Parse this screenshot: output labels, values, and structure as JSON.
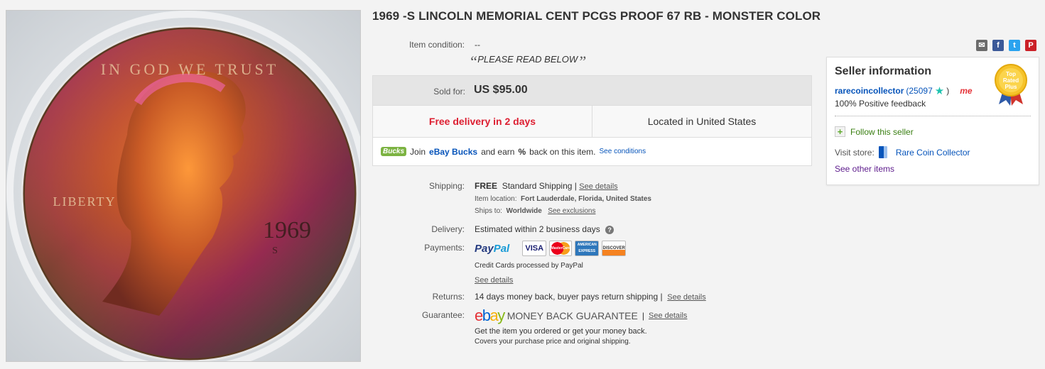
{
  "title": "1969 -S LINCOLN MEMORIAL CENT PCGS PROOF 67 RB - MONSTER COLOR",
  "condition": {
    "label": "Item condition:",
    "value": "--",
    "note": "PLEASE READ BELOW",
    "open_quote": "“",
    "close_quote": "”"
  },
  "share_icons": [
    "email-icon",
    "facebook-icon",
    "twitter-icon",
    "pinterest-icon"
  ],
  "sold": {
    "label": "Sold for:",
    "price": "US $95.00",
    "delivery": "Free delivery in 2 days",
    "location": "Located in United States"
  },
  "bucks": {
    "badge": "Bucks",
    "join": "Join",
    "brand": "eBay Bucks",
    "and_earn": "and earn",
    "percent": "%",
    "back_text": "back on this item.",
    "see_conditions": "See conditions"
  },
  "shipping": {
    "label": "Shipping:",
    "free": "FREE",
    "method": "Standard Shipping",
    "sep": "|",
    "see_details": "See details",
    "item_location_label": "Item location:",
    "item_location": "Fort Lauderdale, Florida, United States",
    "ships_to_label": "Ships to:",
    "ships_to": "Worldwide",
    "see_exclusions": "See exclusions"
  },
  "delivery": {
    "label": "Delivery:",
    "value": "Estimated within 2 business days",
    "help": "?"
  },
  "payments": {
    "label": "Payments:",
    "paypal_pay": "Pay",
    "paypal_pal": "Pal",
    "cards": [
      "VISA",
      "MasterCard",
      "AMERICAN EXPRESS",
      "DISCOVER"
    ],
    "note": "Credit Cards processed by PayPal",
    "see_details": "See details"
  },
  "returns": {
    "label": "Returns:",
    "value": "14 days money back, buyer pays return shipping",
    "sep": "|",
    "see_details": "See details"
  },
  "guarantee": {
    "label": "Guarantee:",
    "logo_e": "e",
    "logo_b": "b",
    "logo_a": "a",
    "logo_y": "y",
    "text": "MONEY BACK GUARANTEE",
    "sep": "|",
    "see_details": "See details",
    "line1": "Get the item you ordered or get your money back.",
    "line2": "Covers your purchase price and original shipping."
  },
  "seller": {
    "heading": "Seller information",
    "name": "rarecoincollector",
    "score_open": "(25097",
    "score_close": ")",
    "me_badge": "me",
    "feedback": "100% Positive feedback",
    "follow": "Follow this seller",
    "visit_label": "Visit store:",
    "store": "Rare Coin Collector",
    "see_other": "See other items",
    "badge_text": [
      "Top",
      "Rated",
      "Plus"
    ]
  },
  "coin": {
    "motto": "IN GOD WE TRUST",
    "liberty": "LIBERTY",
    "year": "1969",
    "mint": "S"
  },
  "colors": {
    "delivery_red": "#dd1e31",
    "link_blue": "#0654ba",
    "purple": "#5d1b8c"
  }
}
